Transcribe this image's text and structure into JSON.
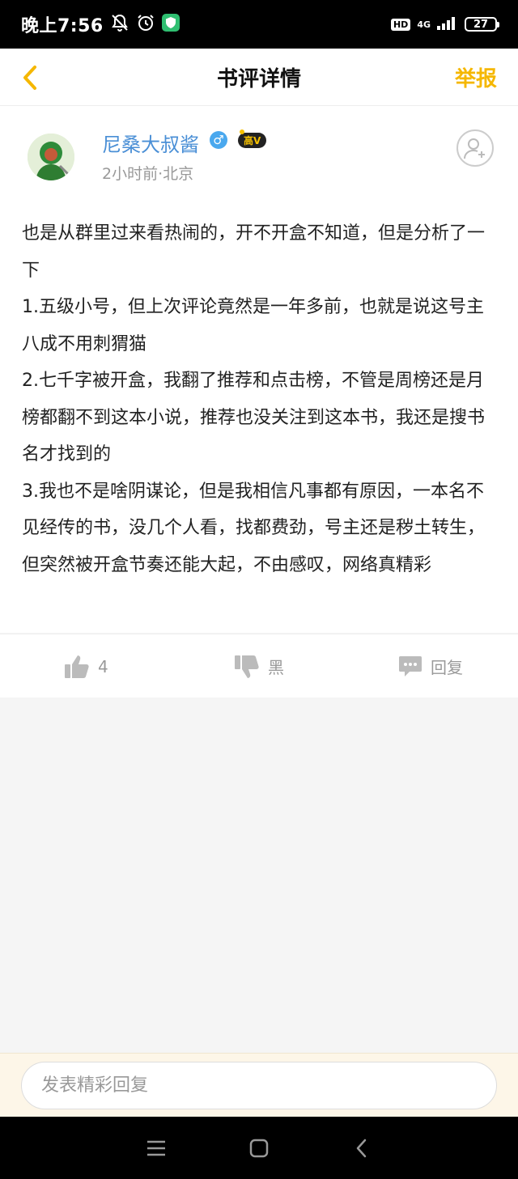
{
  "status_bar": {
    "time": "晚上7:56",
    "hd": "HD",
    "network": "4G",
    "battery": "27"
  },
  "header": {
    "title": "书评详情",
    "report_label": "举报"
  },
  "post": {
    "author": "尼桑大叔酱",
    "gender_symbol": "♂",
    "vip_label": "高V",
    "meta": "2小时前·北京",
    "content": "也是从群里过来看热闹的，开不开盒不知道，但是分析了一下\n1.五级小号，但上次评论竟然是一年多前，也就是说这号主八成不用刺猬猫\n2.七千字被开盒，我翻了推荐和点击榜，不管是周榜还是月榜都翻不到这本小说，推荐也没关注到这本书，我还是搜书名才找到的\n3.我也不是啥阴谋论，但是我相信凡事都有原因，一本名不见经传的书，没几个人看，找都费劲，号主还是秽土转生，但突然被开盒节奏还能大起，不由感叹，网络真精彩"
  },
  "actions": {
    "like_count": "4",
    "dislike_label": "黑",
    "reply_label": "回复"
  },
  "reply_box": {
    "placeholder": "发表精彩回复"
  },
  "colors": {
    "accent": "#f5b700",
    "author_name": "#4a8fd6",
    "muted": "#999999"
  }
}
